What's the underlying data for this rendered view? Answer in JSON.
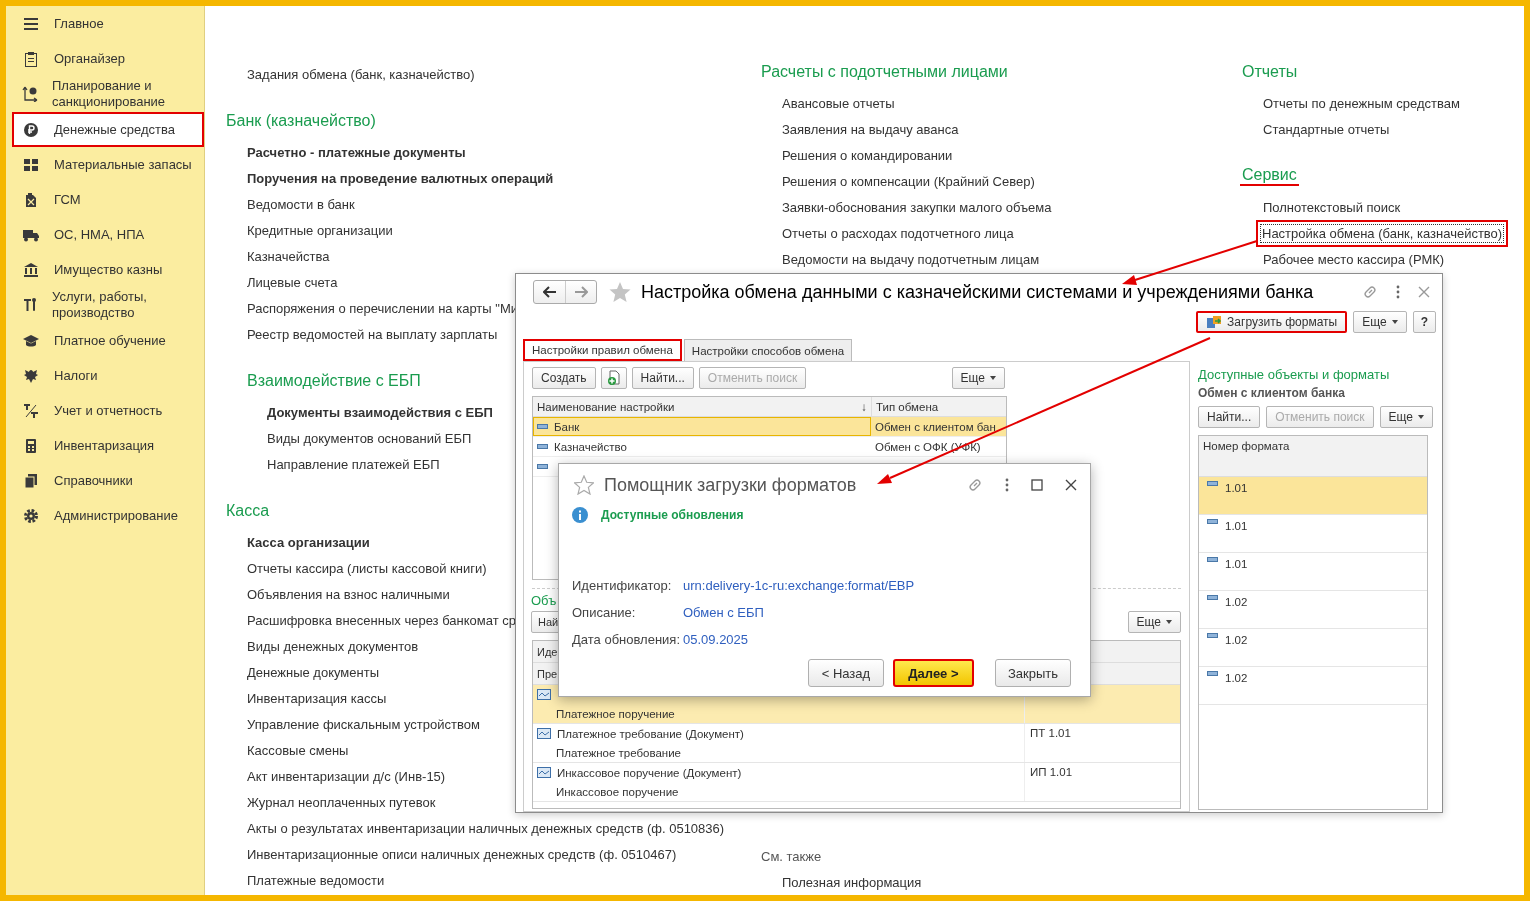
{
  "sidebar": {
    "items": [
      {
        "label": "Главное",
        "selected": false,
        "highlighted": false
      },
      {
        "label": "Органайзер",
        "selected": false,
        "highlighted": false
      },
      {
        "label": "Планирование и санкционирование",
        "selected": false,
        "highlighted": false
      },
      {
        "label": "Денежные средства",
        "selected": true,
        "highlighted": true
      },
      {
        "label": "Материальные запасы",
        "selected": false,
        "highlighted": false
      },
      {
        "label": "ГСМ",
        "selected": false,
        "highlighted": false
      },
      {
        "label": "ОС, НМА, НПА",
        "selected": false,
        "highlighted": false
      },
      {
        "label": "Имущество казны",
        "selected": false,
        "highlighted": false
      },
      {
        "label": "Услуги, работы, производство",
        "selected": false,
        "highlighted": false
      },
      {
        "label": "Платное обучение",
        "selected": false,
        "highlighted": false
      },
      {
        "label": "Налоги",
        "selected": false,
        "highlighted": false
      },
      {
        "label": "Учет и отчетность",
        "selected": false,
        "highlighted": false
      },
      {
        "label": "Инвентаризация",
        "selected": false,
        "highlighted": false
      },
      {
        "label": "Справочники",
        "selected": false,
        "highlighted": false
      },
      {
        "label": "Администрирование",
        "selected": false,
        "highlighted": false
      }
    ]
  },
  "columns": [
    {
      "groups": [
        {
          "items": [
            {
              "text": "Задания обмена (банк, казначейство)",
              "bold": false,
              "highlighted": false
            }
          ]
        },
        {
          "heading": "Банк (казначейство)",
          "highlighted": false,
          "items": [
            {
              "text": "Расчетно - платежные документы",
              "bold": true,
              "highlighted": false
            },
            {
              "text": "Поручения на проведение валютных операций",
              "bold": true,
              "highlighted": false
            },
            {
              "text": "Ведомости в банк",
              "bold": false,
              "highlighted": false
            },
            {
              "text": "Кредитные организации",
              "bold": false,
              "highlighted": false
            },
            {
              "text": "Казначейства",
              "bold": false,
              "highlighted": false
            },
            {
              "text": "Лицевые счета",
              "bold": false,
              "highlighted": false
            },
            {
              "text": "Распоряжения о перечислении на карты \"Ми",
              "bold": false,
              "highlighted": false
            },
            {
              "text": "Реестр ведомостей на выплату зарплаты",
              "bold": false,
              "highlighted": false
            }
          ],
          "children": [
            {
              "heading": "Взаимодействие с ЕБП",
              "highlighted": false,
              "items": [
                {
                  "text": "Документы взаимодействия с ЕБП",
                  "bold": true,
                  "highlighted": false
                },
                {
                  "text": "Виды документов оснований ЕБП",
                  "bold": false,
                  "highlighted": false
                },
                {
                  "text": "Направление платежей ЕБП",
                  "bold": false,
                  "highlighted": false
                }
              ]
            }
          ]
        },
        {
          "heading": "Касса",
          "highlighted": false,
          "items": [
            {
              "text": "Касса организации",
              "bold": true,
              "highlighted": false
            },
            {
              "text": "Отчеты кассира (листы кассовой книги)",
              "bold": false,
              "highlighted": false
            },
            {
              "text": "Объявления на взнос наличными",
              "bold": false,
              "highlighted": false
            },
            {
              "text": "Расшифровка внесенных через банкомат ср",
              "bold": false,
              "highlighted": false
            },
            {
              "text": "Виды денежных документов",
              "bold": false,
              "highlighted": false
            },
            {
              "text": "Денежные документы",
              "bold": false,
              "highlighted": false
            },
            {
              "text": "Инвентаризация кассы",
              "bold": false,
              "highlighted": false
            },
            {
              "text": "Управление фискальным устройством",
              "bold": false,
              "highlighted": false
            },
            {
              "text": "Кассовые смены",
              "bold": false,
              "highlighted": false
            },
            {
              "text": "Акт инвентаризации д/с (Инв-15)",
              "bold": false,
              "highlighted": false
            },
            {
              "text": "Журнал неоплаченных путевок",
              "bold": false,
              "highlighted": false
            },
            {
              "text": "Акты о результатах инвентаризации наличных денежных средств (ф. 0510836)",
              "bold": false,
              "highlighted": false
            },
            {
              "text": "Инвентаризационные описи наличных денежных средств (ф. 0510467)",
              "bold": false,
              "highlighted": false
            },
            {
              "text": "Платежные ведомости",
              "bold": false,
              "highlighted": false
            }
          ]
        }
      ]
    },
    {
      "groups": [
        {
          "heading": "Расчеты с подотчетными лицами",
          "highlighted": false,
          "items": [
            {
              "text": "Авансовые отчеты",
              "bold": false,
              "highlighted": false
            },
            {
              "text": "Заявления на выдачу аванса",
              "bold": false,
              "highlighted": false
            },
            {
              "text": "Решения о командировании",
              "bold": false,
              "highlighted": false
            },
            {
              "text": "Решения о компенсации (Крайний Север)",
              "bold": false,
              "highlighted": false
            },
            {
              "text": "Заявки-обоснования закупки малого объема",
              "bold": false,
              "highlighted": false
            },
            {
              "text": "Отчеты о расходах подотчетного лица",
              "bold": false,
              "highlighted": false
            },
            {
              "text": "Ведомости на выдачу подотчетным лицам",
              "bold": false,
              "highlighted": false
            }
          ]
        }
      ],
      "see_also": {
        "label": "См. также",
        "items": [
          {
            "text": "Полезная информация",
            "bold": false,
            "highlighted": false
          }
        ]
      }
    },
    {
      "groups": [
        {
          "heading": "Отчеты",
          "highlighted": false,
          "items": [
            {
              "text": "Отчеты по денежным средствам",
              "bold": false,
              "highlighted": false
            },
            {
              "text": "Стандартные отчеты",
              "bold": false,
              "highlighted": false
            }
          ]
        },
        {
          "heading": "Сервис",
          "highlighted": true,
          "items": [
            {
              "text": "Полнотекстовый поиск",
              "bold": false,
              "highlighted": false
            },
            {
              "text": "Настройка обмена (банк, казначейство)",
              "bold": false,
              "highlighted": true
            },
            {
              "text": "Рабочее место кассира (РМК)",
              "bold": false,
              "highlighted": false
            }
          ]
        }
      ]
    }
  ],
  "exchange_window": {
    "title": "Настройка обмена данными с казначейскими системами и учреждениями банка",
    "actions": [
      {
        "label": "Загрузить форматы",
        "kind": "load",
        "highlighted": true
      },
      {
        "label": "Еще",
        "kind": "menu",
        "highlighted": false
      },
      {
        "label": "?",
        "kind": "help",
        "highlighted": false
      }
    ],
    "tabs": [
      {
        "label": "Настройки правил обмена",
        "selected": true,
        "highlighted": true
      },
      {
        "label": "Настройки способов обмена",
        "selected": false,
        "highlighted": false
      }
    ],
    "toolbar": [
      {
        "label": "Создать",
        "kind": "button",
        "disabled": false
      },
      {
        "kind": "icon",
        "disabled": false
      },
      {
        "label": "Найти...",
        "kind": "button",
        "disabled": false
      },
      {
        "label": "Отменить поиск",
        "kind": "button",
        "disabled": true
      },
      {
        "label": "Еще",
        "kind": "menu",
        "disabled": false
      }
    ],
    "settings_table": {
      "columns": [
        {
          "label": "Наименование настройки",
          "sort_mark": "↓"
        },
        {
          "label": "Тип обмена"
        }
      ],
      "rows": [
        {
          "name": "Банк",
          "type": "Обмен с клиентом бан",
          "selected": true
        },
        {
          "name": "Казначейство",
          "type": "Обмен с ОФК (УФК)",
          "selected": false
        },
        {
          "selected": false
        }
      ]
    },
    "objects": {
      "heading": "Объ",
      "toolbar": [
        {
          "label": "Най",
          "kind": "button",
          "disabled": false
        },
        {
          "label": "Еще",
          "kind": "menu",
          "disabled": false
        }
      ],
      "header": [
        "Иде",
        "Пре"
      ],
      "rows": [
        {
          "subtitle": "Платежное поручение",
          "selected": true
        },
        {
          "name": "Платежное требование (Документ)",
          "subtitle": "Платежное требование",
          "format": "ПТ 1.01",
          "selected": false
        },
        {
          "name": "Инкассовое поручение (Документ)",
          "subtitle": "Инкассовое поручение",
          "format": "ИП 1.01",
          "selected": false
        }
      ]
    },
    "formats": {
      "heading": "Доступные объекты и форматы",
      "subheading": "Обмен с клиентом банка",
      "toolbar": [
        {
          "label": "Найти...",
          "kind": "button",
          "disabled": false
        },
        {
          "label": "Отменить поиск",
          "kind": "button",
          "disabled": true
        },
        {
          "label": "Еще",
          "kind": "menu",
          "disabled": false
        }
      ],
      "column": "Номер формата",
      "rows": [
        {
          "text": "1.01",
          "selected": true
        },
        {
          "text": "1.01",
          "selected": false
        },
        {
          "text": "1.01",
          "selected": false
        },
        {
          "text": "1.02",
          "selected": false
        },
        {
          "text": "1.02",
          "selected": false
        },
        {
          "text": "1.02",
          "selected": false
        }
      ]
    }
  },
  "dialog": {
    "title": "Помощник загрузки форматов",
    "status": "Доступные обновления",
    "fields": [
      {
        "label": "Идентификатор:",
        "value": "urn:delivery-1c-ru:exchange:format/EBP"
      },
      {
        "label": "Описание:",
        "value": "Обмен с ЕБП"
      },
      {
        "label": "Дата обновления:",
        "value": "05.09.2025"
      }
    ],
    "buttons": [
      {
        "label": "< Назад",
        "kind": "normal",
        "highlighted": false
      },
      {
        "label": "Далее >",
        "kind": "default",
        "highlighted": true
      },
      {
        "label": "Закрыть",
        "kind": "normal",
        "highlighted": false
      }
    ]
  }
}
